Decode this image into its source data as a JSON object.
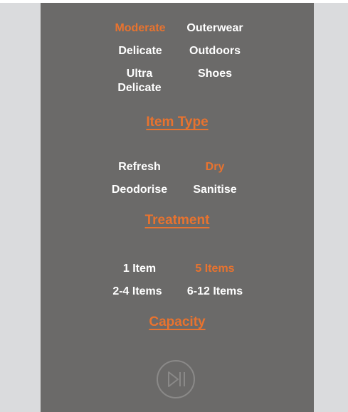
{
  "item_type": {
    "heading": "Item Type",
    "options": [
      {
        "label": "Moderate",
        "selected": true
      },
      {
        "label": "Outerwear",
        "selected": false
      },
      {
        "label": "Delicate",
        "selected": false
      },
      {
        "label": "Outdoors",
        "selected": false
      },
      {
        "label": "Ultra Delicate",
        "selected": false
      },
      {
        "label": "Shoes",
        "selected": false
      }
    ]
  },
  "treatment": {
    "heading": "Treatment",
    "options": [
      {
        "label": "Refresh",
        "selected": false
      },
      {
        "label": "Dry",
        "selected": true
      },
      {
        "label": "Deodorise",
        "selected": false
      },
      {
        "label": "Sanitise",
        "selected": false
      }
    ]
  },
  "capacity": {
    "heading": "Capacity",
    "options": [
      {
        "label": "1 Item",
        "selected": false
      },
      {
        "label": "5 Items",
        "selected": true
      },
      {
        "label": "2-4 Items",
        "selected": false
      },
      {
        "label": "6-12 Items",
        "selected": false
      }
    ]
  },
  "controls": {
    "play_pause_icon": "play-pause-icon"
  },
  "colors": {
    "panel": "#6b6a69",
    "accent": "#e8732f",
    "side": "#dadbdd",
    "text": "#ffffff"
  }
}
